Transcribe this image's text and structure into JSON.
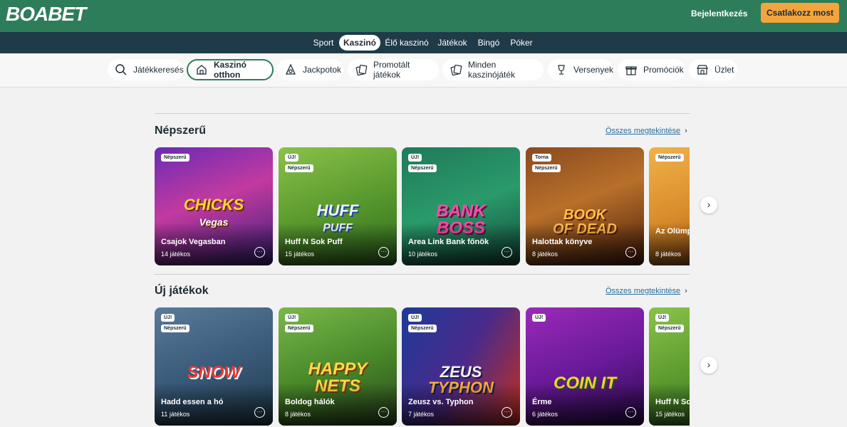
{
  "header": {
    "logo": "BOABET",
    "login_label": "Bejelentkezés",
    "join_label": "Csatlakozz most"
  },
  "nav": {
    "items": [
      {
        "label": "Sport"
      },
      {
        "label": "Kaszinó"
      },
      {
        "label": "Élő kaszinó"
      },
      {
        "label": "Játékok"
      },
      {
        "label": "Bingó"
      },
      {
        "label": "Póker"
      }
    ],
    "active": "Kaszinó"
  },
  "categories": [
    {
      "label": "Játékkeresés",
      "icon": "search-icon"
    },
    {
      "label": "Kaszinó otthon",
      "icon": "home-icon"
    },
    {
      "label": "Jackpotok",
      "icon": "jackpot-icon"
    },
    {
      "label": "Promotált játékok",
      "icon": "promoted-cards-icon"
    },
    {
      "label": "Minden kaszinójáték",
      "icon": "cards-icon"
    },
    {
      "label": "Versenyek",
      "icon": "trophy-icon"
    },
    {
      "label": "Promóciók",
      "icon": "gift-icon"
    },
    {
      "label": "Üzlet",
      "icon": "store-icon"
    }
  ],
  "sections": [
    {
      "title": "Népszerű",
      "see_all": "Összes megtekintése",
      "games": [
        {
          "title": "Csajok Vegasban",
          "count": "14 játékos",
          "badges": [
            "Népszerű"
          ],
          "art": "CHICKS\nVegas"
        },
        {
          "title": "Huff N Sok Puff",
          "count": "15 játékos",
          "badges": [
            "ÚJ!",
            "Népszerű"
          ],
          "art": "HUFF\nPUFF"
        },
        {
          "title": "Area Link Bank főnök",
          "count": "10 játékos",
          "badges": [
            "ÚJ!",
            "Népszerű"
          ],
          "art": "BANK\nBOSS"
        },
        {
          "title": "Halottak könyve",
          "count": "8 játékos",
          "badges": [
            "Torna",
            "Népszerű"
          ],
          "art": "BOOK\nOF DEAD"
        },
        {
          "title": "Az Olümposz szuperszlot",
          "count": "8 játékos",
          "badges": [
            "Népszerű"
          ],
          "art": ""
        }
      ]
    },
    {
      "title": "Új játékok",
      "see_all": "Összes megtekintése",
      "games": [
        {
          "title": "Hadd essen a hó",
          "count": "11 játékos",
          "badges": [
            "ÚJ!",
            "Népszerű"
          ],
          "art": "SNOW"
        },
        {
          "title": "Boldog hálók",
          "count": "8 játékos",
          "badges": [
            "ÚJ!",
            "Népszerű"
          ],
          "art": "HAPPY\nNETS"
        },
        {
          "title": "Zeusz vs. Typhon",
          "count": "7 játékos",
          "badges": [
            "ÚJ!",
            "Népszerű"
          ],
          "art": "ZEUS\nTYPHON"
        },
        {
          "title": "Érme",
          "count": "6 játékos",
          "badges": [
            "ÚJ!"
          ],
          "art": "COIN IT"
        },
        {
          "title": "Huff N Sok Puff",
          "count": "15 játékos",
          "badges": [
            "ÚJ!",
            "Népszerű"
          ],
          "art": ""
        }
      ]
    }
  ],
  "colors": {
    "brand_green": "#2e7d5a",
    "nav_dark": "#1f3a48",
    "join_orange": "#f4a43c"
  }
}
